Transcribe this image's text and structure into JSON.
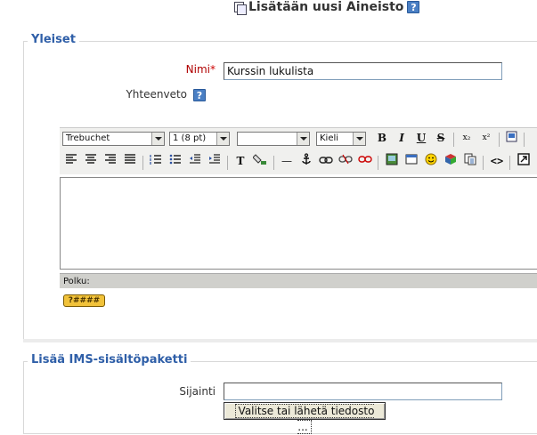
{
  "heading": {
    "title": "Lisätään uusi Aineisto",
    "help_glyph": "?"
  },
  "general_section": {
    "legend": "Yleiset",
    "name_label": "Nimi",
    "required_mark": "*",
    "name_value": "Kurssin lukulista",
    "summary_label": "Yhteenveto",
    "help_glyph": "?"
  },
  "editor": {
    "font_family": "Trebuchet",
    "font_size": "1 (8 pt)",
    "format": "",
    "language": "Kieli",
    "buttons": {
      "bold": "B",
      "italic": "I",
      "underline": "U",
      "strike": "S",
      "subscript": "x₂",
      "superscript": "x²",
      "text_color": "T",
      "hr": "—",
      "link": "⚭",
      "source": "<>"
    },
    "path_label": "Polku:",
    "keyboard_label": "?####"
  },
  "ims_section": {
    "legend": "Lisää IMS-sisältöpaketti",
    "location_label": "Sijainti",
    "location_value": "",
    "choose_button": "Valitse tai lähetä tiedosto ..."
  }
}
